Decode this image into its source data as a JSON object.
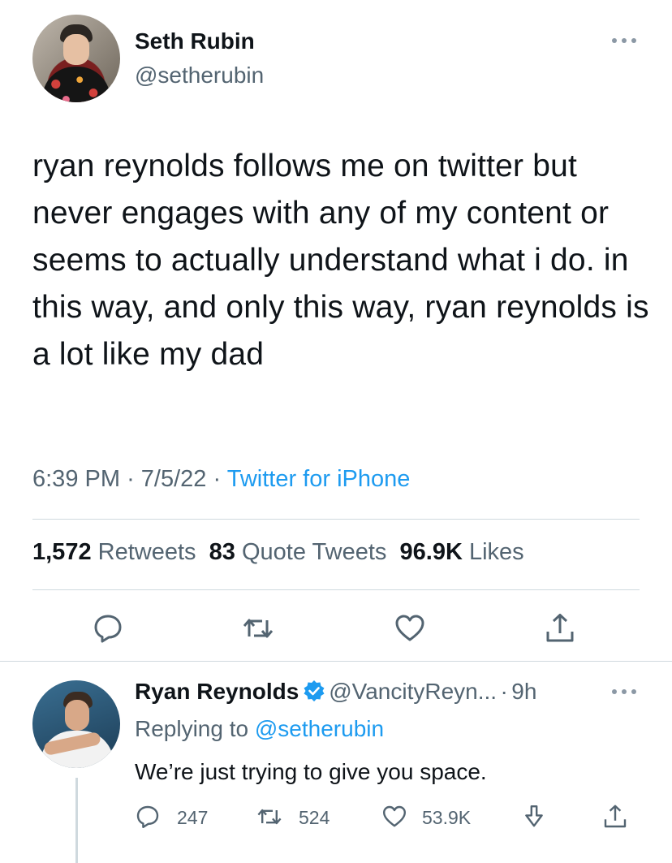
{
  "tweet": {
    "author_name": "Seth Rubin",
    "author_handle": "@setherubin",
    "text": "ryan reynolds follows me on twitter but never engages with any of my content or seems to actually understand what i do. in this way, and only this way, ryan reynolds is a lot like my dad",
    "time": "6:39 PM",
    "date": "7/5/22",
    "separator": "·",
    "source": "Twitter for iPhone",
    "stats": {
      "retweets_count": "1,572",
      "retweets_label": "Retweets",
      "quotes_count": "83",
      "quotes_label": "Quote Tweets",
      "likes_count": "96.9K",
      "likes_label": "Likes"
    },
    "actions": [
      "reply-icon",
      "retweet-icon",
      "like-icon",
      "share-icon"
    ]
  },
  "reply": {
    "author_name": "Ryan Reynolds",
    "verified": true,
    "author_handle": "@VancityReyn...",
    "separator": "·",
    "age": "9h",
    "replying_to_label": "Replying to",
    "replying_to_handle": "@setherubin",
    "text": "We’re just trying to give you space.",
    "reply_count": "247",
    "retweet_count": "524",
    "like_count": "53.9K",
    "actions": [
      "reply-icon",
      "retweet-icon",
      "like-icon",
      "download-icon",
      "share-icon"
    ]
  },
  "colors": {
    "accent": "#1d9bf0",
    "text": "#0f1419",
    "secondary": "#536471",
    "divider": "#cfd9de"
  }
}
